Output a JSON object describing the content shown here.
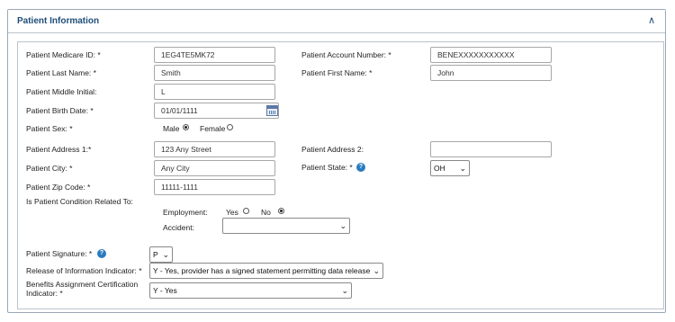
{
  "panel": {
    "title": "Patient Information",
    "collapse_icon": "chevron-up-icon"
  },
  "fields": {
    "medicare_id": {
      "label": "Patient Medicare ID: *",
      "value": "1EG4TE5MK72"
    },
    "account_number": {
      "label": "Patient Account Number: *",
      "value": "BENEXXXXXXXXXXX"
    },
    "last_name": {
      "label": "Patient Last Name: *",
      "value": "Smith"
    },
    "first_name": {
      "label": "Patient First Name: *",
      "value": "John"
    },
    "middle_initial": {
      "label": "Patient Middle Initial:",
      "value": "L"
    },
    "birth_date": {
      "label": "Patient Birth Date: *",
      "value": "01/01/1111",
      "icon": "calendar-icon"
    },
    "sex": {
      "label": "Patient Sex: *",
      "male_label": "Male",
      "female_label": "Female",
      "selected": "Male"
    },
    "address1": {
      "label": "Patient Address 1:*",
      "value": "123 Any Street"
    },
    "address2": {
      "label": "Patient Address 2:",
      "value": ""
    },
    "city": {
      "label": "Patient City: *",
      "value": "Any City"
    },
    "state": {
      "label": "Patient State: *",
      "value": "OH",
      "help_icon": "help-icon"
    },
    "zip": {
      "label": "Patient Zip Code: *",
      "value": "11111-1111"
    },
    "condition": {
      "label": "Is Patient Condition Related To:",
      "employment_label": "Employment:",
      "yes_label": "Yes",
      "no_label": "No",
      "employment_selected": "No",
      "accident_label": "Accident:",
      "accident_value": ""
    },
    "signature": {
      "label": "Patient Signature: *",
      "value": "P",
      "help_icon": "help-icon"
    },
    "release": {
      "label": "Release of Information Indicator: *",
      "value": "Y - Yes, provider has a signed statement permitting data release"
    },
    "benefits": {
      "label_line1": "Benefits Assignment Certification",
      "label_line2": "Indicator: *",
      "value": "Y - Yes"
    }
  },
  "colors": {
    "title": "#1f4e79",
    "help": "#2a7bc0",
    "border": "#a7a7a7"
  }
}
